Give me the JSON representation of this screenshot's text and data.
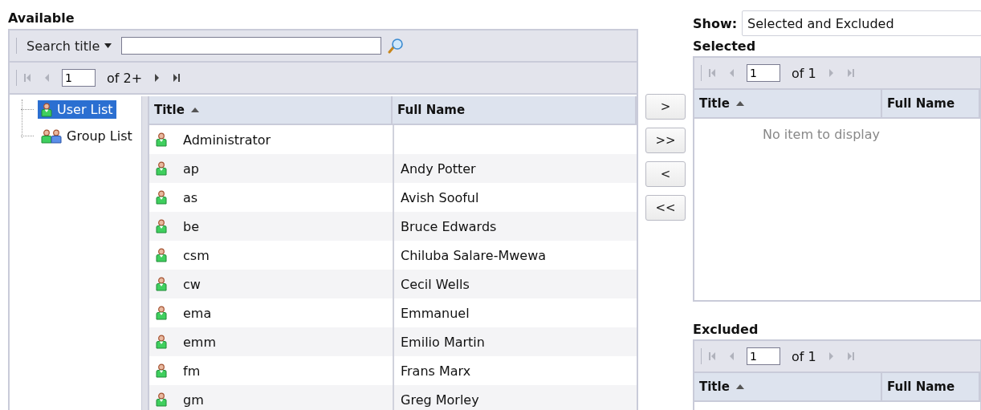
{
  "available": {
    "title": "Available",
    "search": {
      "label": "Search title"
    },
    "pager": {
      "page": "1",
      "of": "of 2+",
      "back_disabled": true,
      "forward_disabled": false
    },
    "tree": [
      {
        "label": "User List",
        "kind": "user",
        "selected": true
      },
      {
        "label": "Group List",
        "kind": "group",
        "selected": false
      }
    ],
    "table": {
      "columns": [
        {
          "label": "Title",
          "sorted": true
        },
        {
          "label": "Full Name",
          "sorted": false
        }
      ],
      "rows": [
        {
          "title": "Administrator"
        },
        {
          "title": "ap",
          "full_name": "Andy Potter"
        },
        {
          "title": "as",
          "full_name": "Avish Sooful"
        },
        {
          "title": "be",
          "full_name": "Bruce Edwards"
        },
        {
          "title": "csm",
          "full_name": "Chiluba Salare-Mwewa"
        },
        {
          "title": "cw",
          "full_name": "Cecil Wells"
        },
        {
          "title": "ema",
          "full_name": "Emmanuel"
        },
        {
          "title": "emm",
          "full_name": "Emilio Martin"
        },
        {
          "title": "fm",
          "full_name": "Frans Marx"
        },
        {
          "title": "gm",
          "full_name": "Greg Morley"
        }
      ]
    }
  },
  "move_buttons": [
    ">",
    ">>",
    "<",
    "<<"
  ],
  "show": {
    "label": "Show:",
    "value": "Selected and Excluded"
  },
  "selected": {
    "title": "Selected",
    "pager": {
      "page": "1",
      "of": "of 1",
      "back_disabled": true,
      "forward_disabled": true
    },
    "columns": [
      {
        "label": "Title",
        "sorted": true
      },
      {
        "label": "Full Name",
        "sorted": false
      }
    ],
    "empty": "No item to display"
  },
  "excluded": {
    "title": "Excluded",
    "pager": {
      "page": "1",
      "of": "of 1",
      "back_disabled": true,
      "forward_disabled": true
    },
    "columns": [
      {
        "label": "Title",
        "sorted": true
      },
      {
        "label": "Full Name",
        "sorted": false
      }
    ]
  }
}
